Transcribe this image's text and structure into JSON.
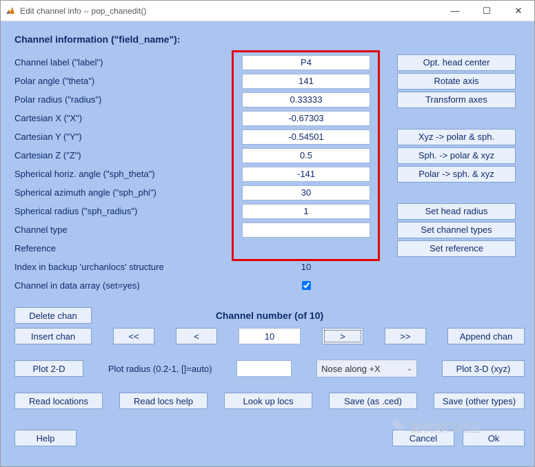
{
  "window": {
    "title": "Edit channel info -- pop_chanedit()",
    "minimize": "—",
    "maximize": "☐",
    "close": "✕"
  },
  "heading": "Channel information (\"field_name\"):",
  "fields": [
    {
      "label": "Channel label (\"label\")",
      "value": "P4"
    },
    {
      "label": "Polar angle (\"theta\")",
      "value": "141"
    },
    {
      "label": "Polar radius (\"radius\")",
      "value": "0.33333"
    },
    {
      "label": "Cartesian X (\"X\")",
      "value": "-0.67303"
    },
    {
      "label": "Cartesian Y (\"Y\")",
      "value": "-0.54501"
    },
    {
      "label": "Cartesian Z (\"Z\")",
      "value": "0.5"
    },
    {
      "label": "Spherical horiz. angle (\"sph_theta\")",
      "value": "-141"
    },
    {
      "label": "Spherical azimuth angle (\"sph_phi\")",
      "value": "30"
    },
    {
      "label": "Spherical radius (\"sph_radius\")",
      "value": "1"
    },
    {
      "label": "Channel type",
      "value": ""
    },
    {
      "label": "Reference",
      "value": ""
    }
  ],
  "side_buttons": {
    "opt_head_center": "Opt. head center",
    "rotate_axis": "Rotate axis",
    "transform_axes": "Transform axes",
    "xyz_polar_sph": "Xyz -> polar & sph.",
    "sph_polar_xyz": "Sph. -> polar & xyz",
    "polar_sph_xyz": "Polar -> sph. & xyz",
    "set_head_radius": "Set head radius",
    "set_channel_types": "Set channel types",
    "set_reference": "Set reference"
  },
  "extra": {
    "backup_label": "Index in backup 'urchanlocs' structure",
    "backup_value": "10",
    "inarray_label": "Channel in data array (set=yes)",
    "inarray_checked": true
  },
  "nav": {
    "delete_chan": "Delete chan",
    "insert_chan": "Insert chan",
    "first": "<<",
    "prev": "<",
    "number": "10",
    "next": ">",
    "last": ">>",
    "append_chan": "Append chan",
    "heading": "Channel number (of 10)"
  },
  "plot": {
    "plot2d": "Plot 2-D",
    "radius_label": "Plot radius (0.2-1, []=auto)",
    "radius_value": "",
    "nose_dropdown": "Nose along +X",
    "plot3d": "Plot 3-D (xyz)"
  },
  "read": {
    "read_locations": "Read locations",
    "read_locs_help": "Read locs help",
    "look_up_locs": "Look up locs",
    "save_ced": "Save (as .ced)",
    "save_other": "Save (other types)"
  },
  "bottom": {
    "help": "Help",
    "cancel": "Cancel",
    "ok": "Ok"
  },
  "watermark": "脑机接口社区"
}
